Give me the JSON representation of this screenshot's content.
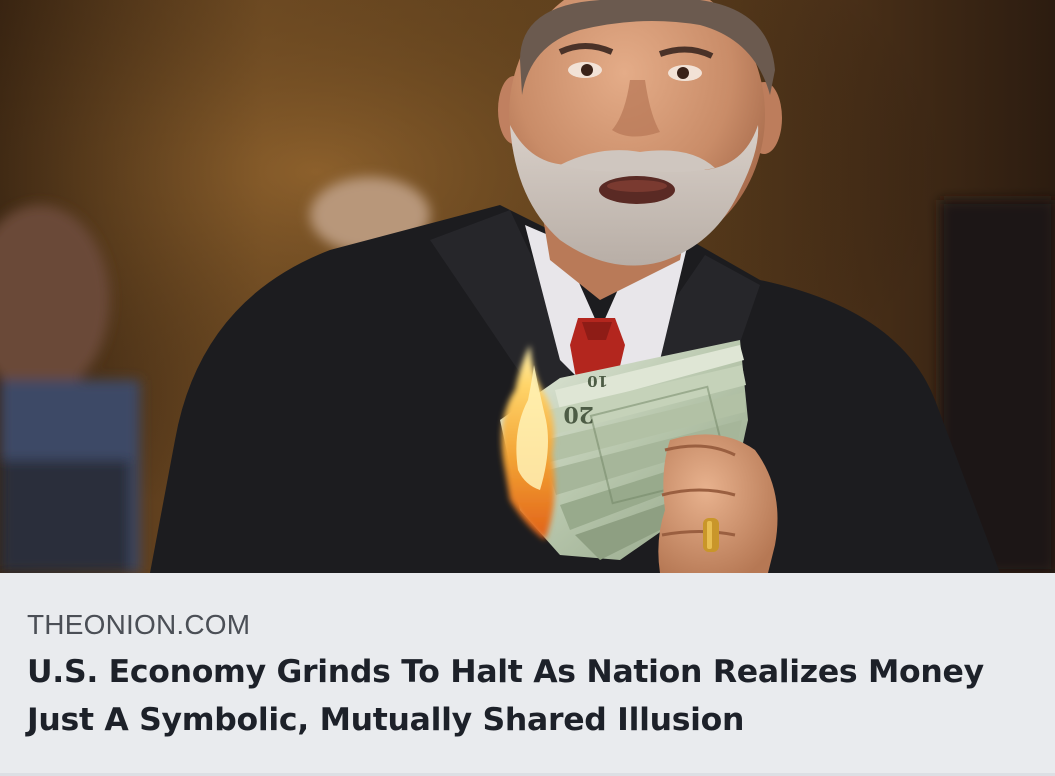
{
  "link_preview": {
    "image_alt": "Man in dark suit holding a burning wad of dollar bills",
    "domain": "THEONION.COM",
    "headline": "U.S. Economy Grinds To Halt As Nation Realizes Money Just A Symbolic, Mutually Shared Illusion"
  },
  "banknote": {
    "denomination_text": "20",
    "partial_text": "10"
  },
  "colors": {
    "caption_background": "#e9ebee",
    "domain_text": "#4b4f56",
    "headline_text": "#1d2129",
    "suit": "#1c1c1f",
    "tie": "#b3261e",
    "flame": "#f2a032",
    "money": "#c9d3bd"
  }
}
